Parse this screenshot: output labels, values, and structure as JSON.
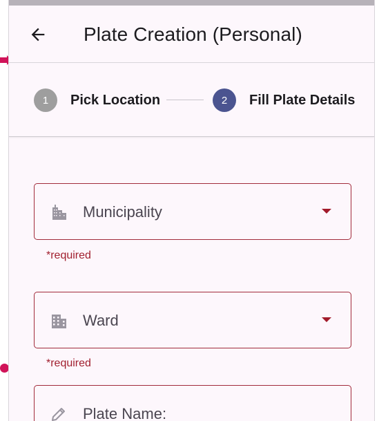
{
  "appbar": {
    "title": "Plate Creation (Personal)",
    "back_icon": "arrow-left-icon"
  },
  "stepper": {
    "steps": [
      {
        "number": "1",
        "label": "Pick Location",
        "state": "inactive",
        "color": "#9e9e9e"
      },
      {
        "number": "2",
        "label": "Fill Plate Details",
        "state": "active",
        "color": "#4b5490"
      }
    ]
  },
  "form": {
    "municipality": {
      "placeholder": "Municipality",
      "helper": "*required",
      "icon": "city-buildings-icon"
    },
    "ward": {
      "placeholder": "Ward",
      "helper": "*required",
      "icon": "apartment-building-icon"
    },
    "plate_name": {
      "placeholder": "Plate Name:",
      "icon": "pencil-icon"
    }
  },
  "colors": {
    "error": "#a12a3a",
    "background": "#fdf7fc",
    "marker": "#d01459"
  }
}
